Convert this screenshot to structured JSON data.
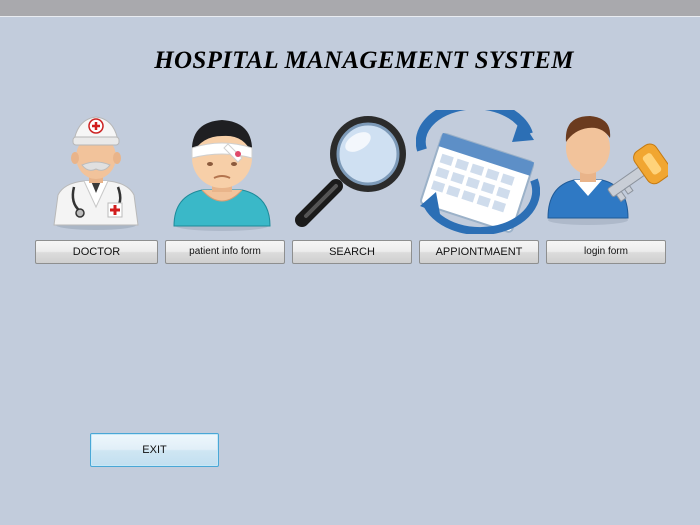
{
  "header": {
    "title": "HOSPITAL MANAGEMENT SYSTEM"
  },
  "menu": {
    "doctor": {
      "label": "DOCTOR",
      "icon": "doctor-icon"
    },
    "patient": {
      "label": "patient info form",
      "icon": "patient-icon"
    },
    "search": {
      "label": "SEARCH",
      "icon": "magnifier-icon"
    },
    "appointment": {
      "label": "APPIONTMAENT",
      "icon": "calendar-icon"
    },
    "login": {
      "label": "login form",
      "icon": "user-key-icon"
    }
  },
  "exit": {
    "label": "EXIT"
  },
  "colors": {
    "background": "#c2ccdc",
    "exit_border": "#4aa7d6"
  }
}
